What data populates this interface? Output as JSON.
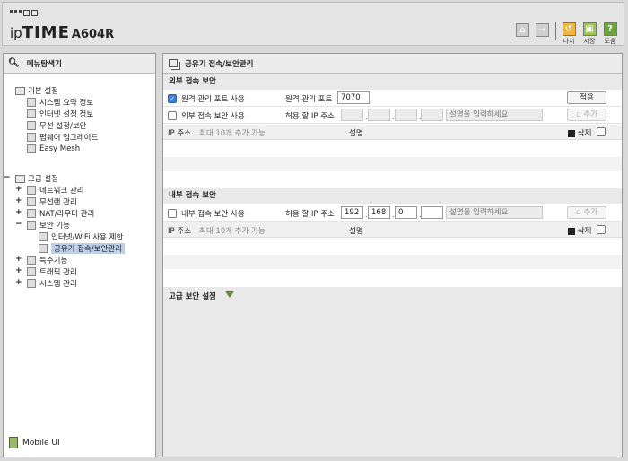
{
  "header": {
    "logo_ip": "ip",
    "logo_time": "TIME",
    "model": "A604R",
    "buttons": [
      {
        "label": "다시",
        "icon": "refresh-icon",
        "color": "#f2b640"
      },
      {
        "label": "저장",
        "icon": "save-icon",
        "color": "#9cc74a"
      },
      {
        "label": "도움",
        "icon": "help-icon",
        "color": "#6aa43a"
      }
    ]
  },
  "sidebar": {
    "title": "메뉴탐색기",
    "groups": [
      {
        "label": "기본 설정",
        "items": [
          "시스템 요약 정보",
          "인터넷 설정 정보",
          "무선 설정/보안",
          "펌웨어 업그레이드",
          "Easy Mesh"
        ]
      },
      {
        "label": "고급 설정",
        "items": [
          "네트워크 관리",
          "무선랜 관리",
          "NAT/라우터 관리",
          "보안 기능",
          "특수기능",
          "트래픽 관리",
          "시스템 관리"
        ],
        "security_items": [
          "인터넷/WiFi 사용 제한",
          "공유기 접속/보안관리"
        ]
      }
    ],
    "mobile_label": "Mobile UI"
  },
  "main": {
    "title": "공유기 접속/보안관리",
    "external": {
      "section_title": "외부 접속 보안",
      "remote_port_checkbox_label": "원격 관리 포트 사용",
      "remote_port_checked": true,
      "remote_port_label": "원격 관리 포트",
      "remote_port_value": "7070",
      "apply_label": "적용",
      "access_checkbox_label": "외부 접속 보안 사용",
      "allowed_ip_label": "허용 할 IP 주소",
      "ip": [
        "",
        "",
        "",
        ""
      ],
      "desc_placeholder": "설명을 입력하세요",
      "add_label": "추가",
      "list_ip_header": "IP 주소",
      "list_limit": "최대 10개 추가 가능",
      "list_desc_header": "설명",
      "delete_label": "삭제"
    },
    "internal": {
      "section_title": "내부 접속 보안",
      "access_checkbox_label": "내부 접속 보안 사용",
      "allowed_ip_label": "허용 할 IP 주소",
      "ip": [
        "192",
        "168",
        "0",
        ""
      ],
      "desc_placeholder": "설명을 입력하세요",
      "add_label": "추가",
      "list_ip_header": "IP 주소",
      "list_limit": "최대 10개 추가 가능",
      "list_desc_header": "설명",
      "delete_label": "삭제"
    },
    "advanced_title": "고급 보안 설정"
  }
}
